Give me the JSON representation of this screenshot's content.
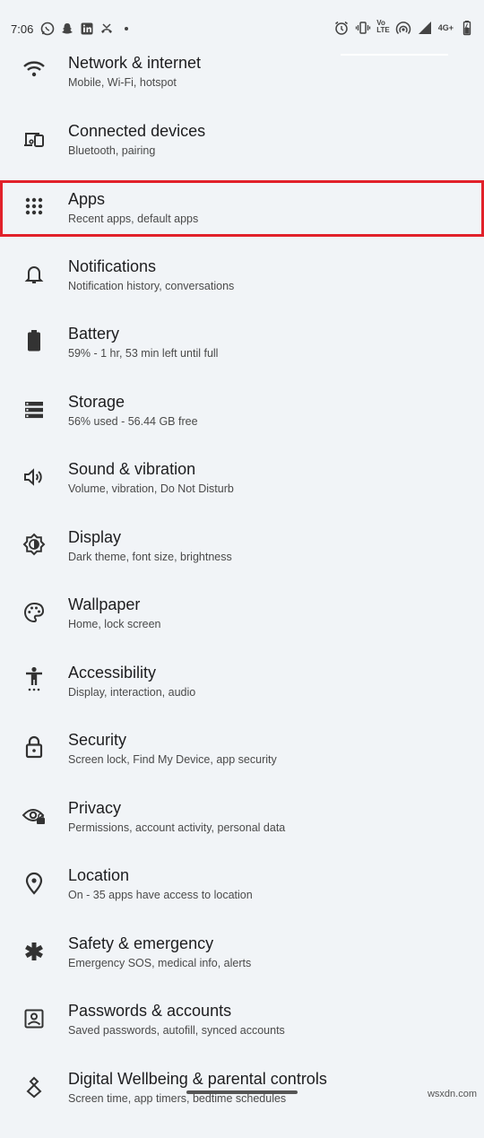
{
  "status_bar": {
    "time": "7:06",
    "left_icons": [
      "whatsapp-icon",
      "snapchat-icon",
      "linkedin-icon",
      "missed-call-icon",
      "dot-icon"
    ],
    "right_icons": [
      "alarm-icon",
      "vibrate-icon",
      "volte-icon",
      "hotspot-icon",
      "signal-icon",
      "4g-icon",
      "battery-icon"
    ],
    "volte_label_top": "Vo",
    "volte_label_mid": "LTE",
    "network_label": "4G+"
  },
  "settings": {
    "items": [
      {
        "title": "Network & internet",
        "subtitle": "Mobile, Wi-Fi, hotspot",
        "icon": "wifi-icon"
      },
      {
        "title": "Connected devices",
        "subtitle": "Bluetooth, pairing",
        "icon": "devices-icon"
      },
      {
        "title": "Apps",
        "subtitle": "Recent apps, default apps",
        "icon": "apps-grid-icon"
      },
      {
        "title": "Notifications",
        "subtitle": "Notification history, conversations",
        "icon": "bell-icon"
      },
      {
        "title": "Battery",
        "subtitle": "59% - 1 hr, 53 min left until full",
        "icon": "battery-icon"
      },
      {
        "title": "Storage",
        "subtitle": "56% used - 56.44 GB free",
        "icon": "storage-icon"
      },
      {
        "title": "Sound & vibration",
        "subtitle": "Volume, vibration, Do Not Disturb",
        "icon": "speaker-icon"
      },
      {
        "title": "Display",
        "subtitle": "Dark theme, font size, brightness",
        "icon": "brightness-icon"
      },
      {
        "title": "Wallpaper",
        "subtitle": "Home, lock screen",
        "icon": "palette-icon"
      },
      {
        "title": "Accessibility",
        "subtitle": "Display, interaction, audio",
        "icon": "accessibility-icon"
      },
      {
        "title": "Security",
        "subtitle": "Screen lock, Find My Device, app security",
        "icon": "lock-icon"
      },
      {
        "title": "Privacy",
        "subtitle": "Permissions, account activity, personal data",
        "icon": "eye-lock-icon"
      },
      {
        "title": "Location",
        "subtitle": "On - 35 apps have access to location",
        "icon": "location-pin-icon"
      },
      {
        "title": "Safety & emergency",
        "subtitle": "Emergency SOS, medical info, alerts",
        "icon": "asterisk-icon"
      },
      {
        "title": "Passwords & accounts",
        "subtitle": "Saved passwords, autofill, synced accounts",
        "icon": "account-box-icon"
      },
      {
        "title": "Digital Wellbeing & parental controls",
        "subtitle": "Screen time, app timers, bedtime schedules",
        "icon": "wellbeing-icon"
      }
    ]
  },
  "highlight_color": "#e1212a",
  "watermark": "wsxdn.com"
}
